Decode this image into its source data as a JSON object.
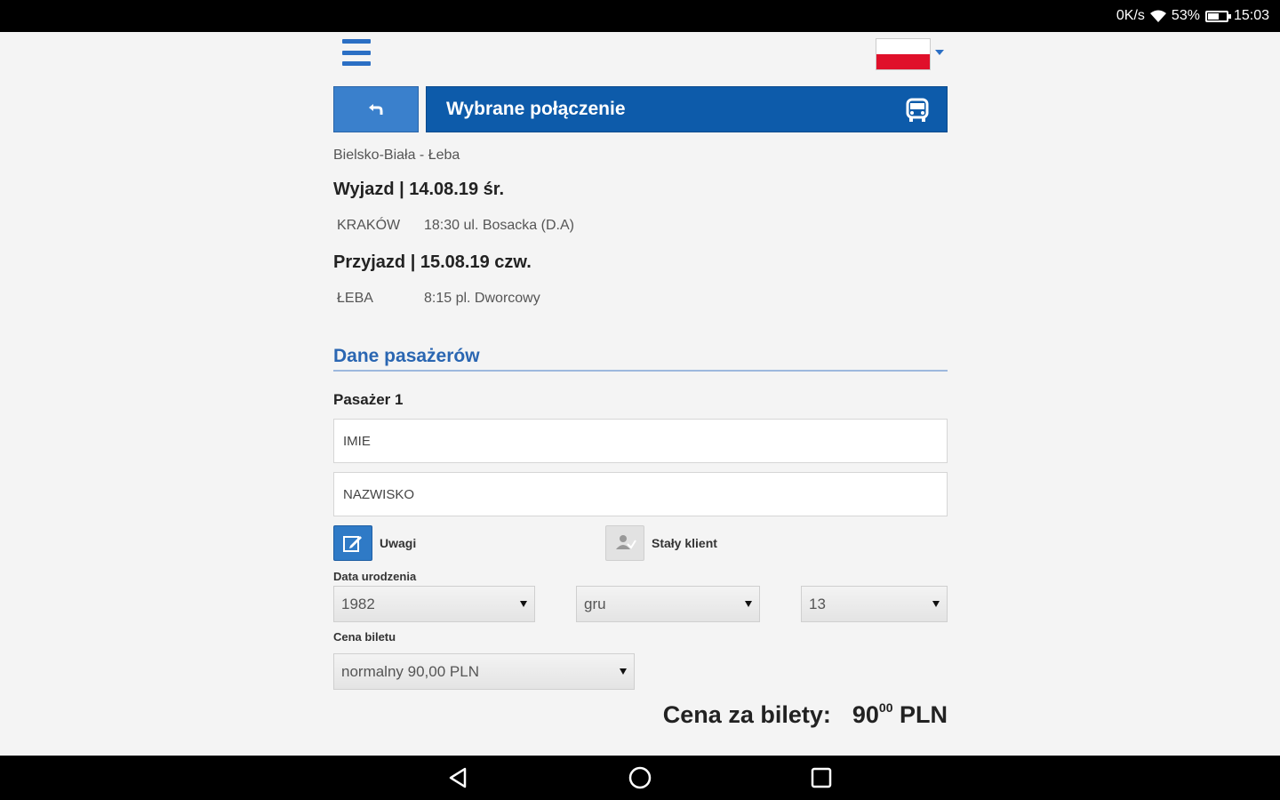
{
  "status_bar": {
    "net_speed": "0K/s",
    "battery": "53%",
    "time": "15:03"
  },
  "header": {
    "title": "Wybrane połączenie",
    "language": "PL"
  },
  "trip": {
    "route": "Bielsko-Biała - Łeba",
    "departure_heading": "Wyjazd | 14.08.19 śr.",
    "departure_city": "KRAKÓW",
    "departure_detail": "18:30 ul. Bosacka (D.A)",
    "arrival_heading": "Przyjazd | 15.08.19 czw.",
    "arrival_city": "ŁEBA",
    "arrival_detail": "8:15 pl. Dworcowy"
  },
  "passengers": {
    "section_title": "Dane pasażerów",
    "passenger_label": "Pasażer 1",
    "first_name_placeholder": "IMIE",
    "last_name_placeholder": "NAZWISKO",
    "notes_label": "Uwagi",
    "regular_client_label": "Stały klient",
    "birth_date_label": "Data urodzenia",
    "birth_year": "1982",
    "birth_month": "gru",
    "birth_day": "13",
    "ticket_price_label": "Cena biletu",
    "ticket_type": "normalny 90,00 PLN"
  },
  "total": {
    "label": "Cena za bilety:",
    "amount_main": "90",
    "amount_cents": "00",
    "currency": "PLN"
  },
  "colors": {
    "primary": "#0d5baa",
    "accent": "#2b6fc4"
  }
}
